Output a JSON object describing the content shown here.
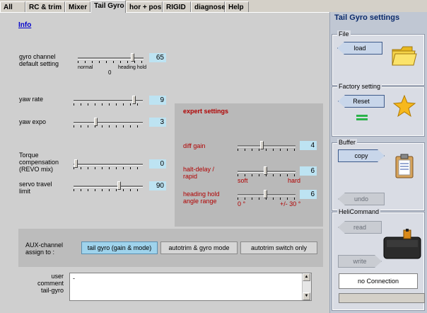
{
  "tabs": [
    {
      "label": "All"
    },
    {
      "label": "RC & trim"
    },
    {
      "label": "Mixer"
    },
    {
      "label": "Tail Gyro"
    },
    {
      "label": "hor + pos"
    },
    {
      "label": "RIGID"
    },
    {
      "label": "diagnose"
    },
    {
      "label": "Help"
    }
  ],
  "main": {
    "info_link": "Info",
    "gyro_channel": {
      "label_line1": "gyro channel",
      "label_line2": "default setting",
      "value": "65",
      "left_label": "normal",
      "right_label": "heading hold",
      "zero_label": "0"
    },
    "yaw_rate": {
      "label": "yaw rate",
      "value": "9"
    },
    "yaw_expo": {
      "label": "yaw expo",
      "value": "3"
    },
    "torque": {
      "label_line1": "Torque",
      "label_line2": "compensation",
      "label_line3": "(REVO mix)",
      "value": "0"
    },
    "servo_travel": {
      "label_line1": "servo travel",
      "label_line2": "limit",
      "value": "90"
    },
    "expert": {
      "title": "expert settings",
      "diff_gain": {
        "label": "diff gain",
        "value": "4"
      },
      "halt_delay": {
        "label_line1": "halt-delay /",
        "label_line2": "rapid",
        "value": "6",
        "left_label": "soft",
        "right_label": "hard"
      },
      "heading_hold": {
        "label_line1": "heading hold",
        "label_line2": "angle range",
        "value": "6",
        "left_label": "0 °",
        "right_label": "+/- 30 °"
      }
    },
    "aux": {
      "label_line1": "AUX-channel",
      "label_line2": "assign to :",
      "buttons": [
        {
          "label": "tail gyro (gain & mode)",
          "selected": true
        },
        {
          "label": "autotrim & gyro mode",
          "selected": false
        },
        {
          "label": "autotrim switch only",
          "selected": false
        }
      ]
    },
    "comment": {
      "label_line1": "user comment",
      "label_line2": "tail-gyro",
      "value": "-"
    }
  },
  "side": {
    "title": "Tail Gyro settings",
    "file": {
      "label": "File",
      "load": "load"
    },
    "factory": {
      "label": "Factory setting",
      "reset": "Reset"
    },
    "buffer": {
      "label": "Buffer",
      "copy": "copy",
      "undo": "undo"
    },
    "helicommand": {
      "label": "HeliCommand",
      "read": "read",
      "write": "write",
      "status": "no Connection",
      "device_label": "HeliCommand"
    }
  },
  "colors": {
    "value_box": "#bde3f2",
    "selected_button": "#9fd3ec",
    "expert_text": "#b00000",
    "link": "#0000cc"
  }
}
